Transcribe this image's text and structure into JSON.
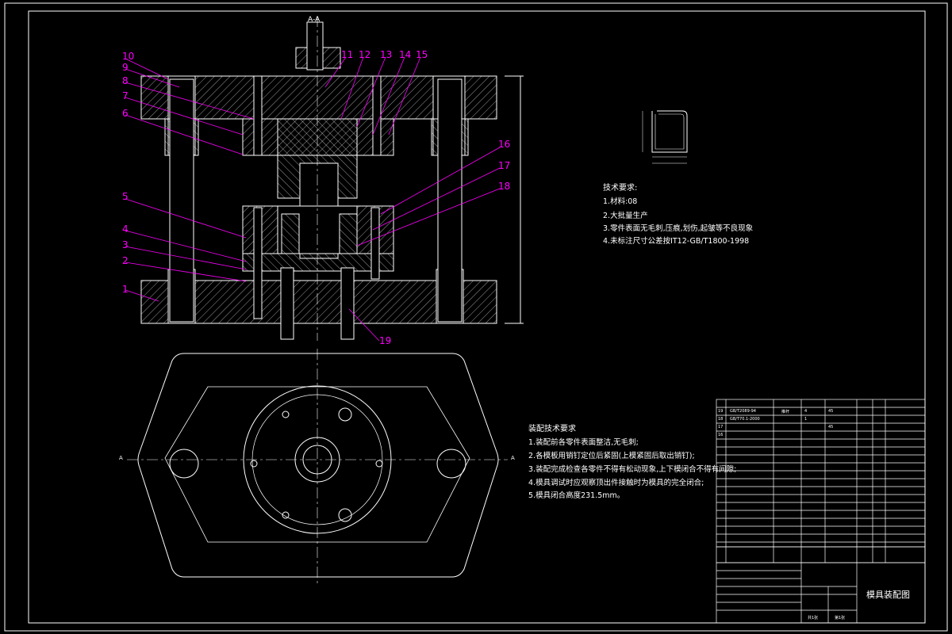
{
  "section_label": "A-A",
  "section_marks": [
    "A",
    "A"
  ],
  "part_numbers": [
    "1",
    "2",
    "3",
    "4",
    "5",
    "6",
    "7",
    "8",
    "9",
    "10",
    "11",
    "12",
    "13",
    "14",
    "15",
    "16",
    "17",
    "18",
    "19"
  ],
  "part_tech": {
    "title": "技术要求:",
    "items": [
      "1.材料:08",
      "2.大批量生产",
      "3.零件表面无毛刺,压痕,划伤,起皱等不良现象",
      "4.未标注尺寸公差按IT12-GB/T1800-1998"
    ]
  },
  "assembly_tech": {
    "title": "装配技术要求",
    "items": [
      "1.装配前各零件表面整洁,无毛刺;",
      "2.各模板用销钉定位后紧固(上模紧固后取出销钉);",
      "3.装配完成检查各零件不得有松动现象,上下模闭合不得有间隙;",
      "4.模具调试时应观察顶出件接触时为模具的完全闭合;",
      "5.模具闭合高度231.5mm。"
    ]
  },
  "bom": {
    "rows": [
      [
        "19",
        "GB/T2089-94",
        "推杆",
        "4",
        "45"
      ],
      [
        "18",
        "GB/T70.1-2000",
        "",
        "1",
        ""
      ],
      [
        "17",
        "",
        "",
        "",
        "45"
      ],
      [
        "16",
        "",
        "",
        "",
        ""
      ]
    ]
  },
  "title_block": {
    "drawing_title": "模具装配图",
    "sheets": [
      "共1张",
      "第1张"
    ]
  },
  "colors": {
    "line": "#ffffff",
    "leader": "#ff00ff",
    "hatch": "#ffffff",
    "center": "#ffffff"
  }
}
